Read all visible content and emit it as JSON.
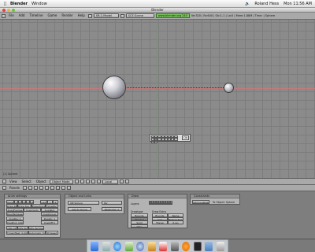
{
  "macbar": {
    "app_name": "Blender",
    "menu_window": "Window",
    "user": "Roland Hess",
    "clock": "Mon 11:56 AM",
    "apple_icon": "apple-icon",
    "volume_icon": "volume-icon"
  },
  "window": {
    "title": "Blender"
  },
  "top_header": {
    "menus": [
      "File",
      "Add",
      "Timeline",
      "Game",
      "Render",
      "Help"
    ],
    "screen_select": "SR:2-Model",
    "scene_select": "SCE:Scene",
    "url": "www.blender.org 240",
    "stats": "Ve:320 | Fa:640 | Ob:1-1 | La:0 | Mem:1.88M | Time: | Sphere"
  },
  "viewport": {
    "object_label": "(1) Sphere",
    "popup_ok": "Ok"
  },
  "viewport_header": {
    "view": "View",
    "select": "Select",
    "object": "Object",
    "mode": "Object Mode",
    "orientation": "Local"
  },
  "buttons_header": {
    "panels": "Panels"
  },
  "panels": {
    "anim": {
      "title": "Anim settings",
      "buttons": [
        "TrackX",
        "Y",
        "Z",
        "-X",
        "-Y",
        "-Z",
        "UpX",
        "Y",
        "Z",
        "Draw Key",
        "Draw Key Sel",
        "Powertrack",
        "SlowPar",
        "DupliFrames",
        "DupliVerts",
        "DupliRot",
        "DupliNoSpeed",
        "DupliGroup",
        "DupSta: 1",
        "DupOn: 1",
        "DupEnd: 100",
        "DupOff 0",
        "Offs Ob",
        "Offs Par",
        "Offs Particle",
        "TimeOffset: 0.000",
        "Automatic Time",
        "PrSpeed"
      ]
    },
    "object": {
      "title": "Object and Links",
      "ob_name": "OB:Sphere",
      "par": "Par",
      "add_group": "Add to Group",
      "pass_index": "PassIndex: 0"
    },
    "draw": {
      "title": "Draw",
      "layers": "Layers",
      "drawtype_label": "Drawtype",
      "draw_extra_label": "Draw Extra",
      "drawtype": [
        "Bounds",
        "Shaded",
        "Solid",
        "Wire"
      ],
      "extra": [
        "Bounds",
        "Name",
        "Axis",
        "Texture Space",
        "Transp",
        "X-ray"
      ]
    },
    "constraints": {
      "title": "Constraints",
      "add": "Add Constraint",
      "target": "To Object: Sphere"
    }
  },
  "dock": {
    "icons": [
      "finder-icon",
      "mail-icon",
      "safari-icon",
      "ichat-icon",
      "itunes-icon",
      "iphoto-icon",
      "ical-icon",
      "preferences-icon",
      "blender-icon",
      "terminal-icon",
      "folder-icon",
      "trash-icon"
    ]
  }
}
